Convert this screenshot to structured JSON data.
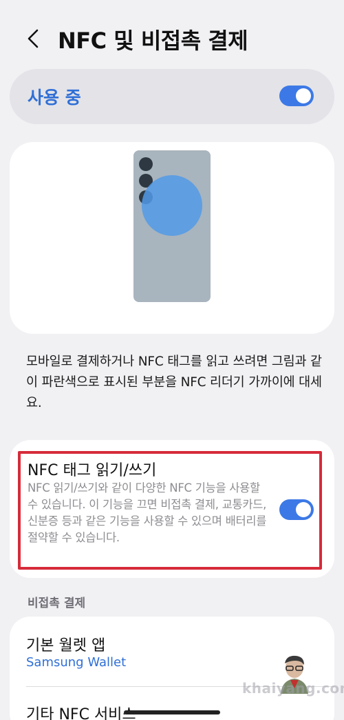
{
  "header": {
    "title": "NFC 및 비접촉 결제"
  },
  "master": {
    "label": "사용 중",
    "enabled": true
  },
  "illustration": {
    "description": "모바일로 결제하거나 NFC 태그를 읽고 쓰려면 그림과 같이 파란색으로 표시된 부분을 NFC 리더기 가까이에 대세요."
  },
  "nfc_tag": {
    "title": "NFC 태그 읽기/쓰기",
    "description": "NFC 읽기/쓰기와 같이 다양한 NFC 기능을 사용할 수 있습니다. 이 기능을 끄면 비접촉 결제, 교통카드, 신분증 등과 같은 기능을 사용할 수 있으며 배터리를 절약할 수 있습니다.",
    "enabled": true
  },
  "contactless": {
    "section_header": "비접촉 결제",
    "default_wallet": {
      "title": "기본 월렛 앱",
      "value": "Samsung Wallet"
    },
    "other_services": {
      "title": "기타 NFC 서비스"
    }
  },
  "watermark": "khaiyang.com",
  "colors": {
    "accent": "#3c79e6",
    "highlight_border": "#d62b3a",
    "background": "#f1f1f4"
  },
  "icons": {
    "back": "chevron-left-icon"
  }
}
